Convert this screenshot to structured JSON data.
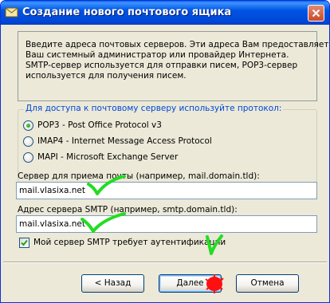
{
  "window": {
    "title": "Создание нового почтового ящика"
  },
  "info": {
    "lines": [
      "Введите адреса почтовых серверов. Эти адреса Вам предоставляет",
      "Ваш системный администратор или провайдер Интернета.",
      "SMTP-сервер используется для отправки писем, POP3-сервер",
      "используется для получения писем."
    ]
  },
  "protocol": {
    "group_label": "Для доступа к почтовому серверу используйте протокол:",
    "options": [
      {
        "label": "POP3  -  Post Office Protocol v3",
        "selected": true
      },
      {
        "label": "IMAP4 - Internet Message Access Protocol",
        "selected": false
      },
      {
        "label": "MAPI - Microsoft Exchange Server",
        "selected": false
      }
    ]
  },
  "incoming": {
    "label": "Сервер для приема почты  (например, mail.domain.tld):",
    "value": "mail.vlasixa.net"
  },
  "smtp": {
    "label": "Адрес сервера SMTP (например, smtp.domain.tld):",
    "value": "mail.vlasixa.net"
  },
  "auth": {
    "label": "Мой сервер SMTP требует аутентификации",
    "checked": true
  },
  "buttons": {
    "back": "< Назад",
    "next": "Далее",
    "cancel": "Отмена"
  },
  "colors": {
    "titlebar": "#0054e3",
    "dialog_bg": "#ece9d8",
    "group_title": "#0046d5",
    "annotation_green": "#22dd22",
    "annotation_red": "#ff1010"
  }
}
